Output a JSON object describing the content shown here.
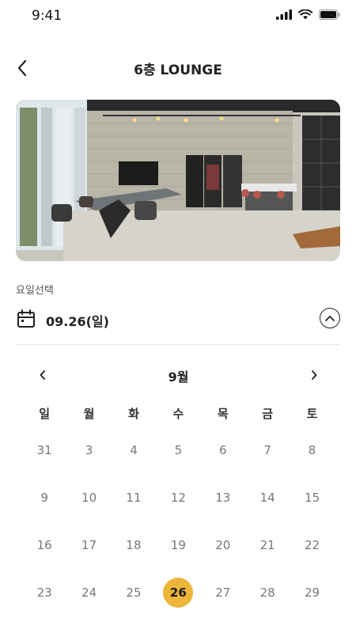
{
  "status": {
    "time": "9:41"
  },
  "header": {
    "title": "6층 LOUNGE"
  },
  "selection": {
    "label": "요일선택",
    "date": "09.26(일)"
  },
  "calendar": {
    "month": "9월",
    "weekdays": [
      "일",
      "월",
      "화",
      "수",
      "목",
      "금",
      "토"
    ],
    "weeks": [
      [
        "31",
        "3",
        "4",
        "5",
        "6",
        "7",
        "8"
      ],
      [
        "9",
        "10",
        "11",
        "12",
        "13",
        "14",
        "15"
      ],
      [
        "16",
        "17",
        "18",
        "19",
        "20",
        "21",
        "22"
      ],
      [
        "23",
        "24",
        "25",
        "26",
        "27",
        "28",
        "29"
      ]
    ],
    "selected": "26"
  },
  "colors": {
    "accent": "#ecb63a",
    "text": "#222222",
    "muted": "#777777"
  }
}
